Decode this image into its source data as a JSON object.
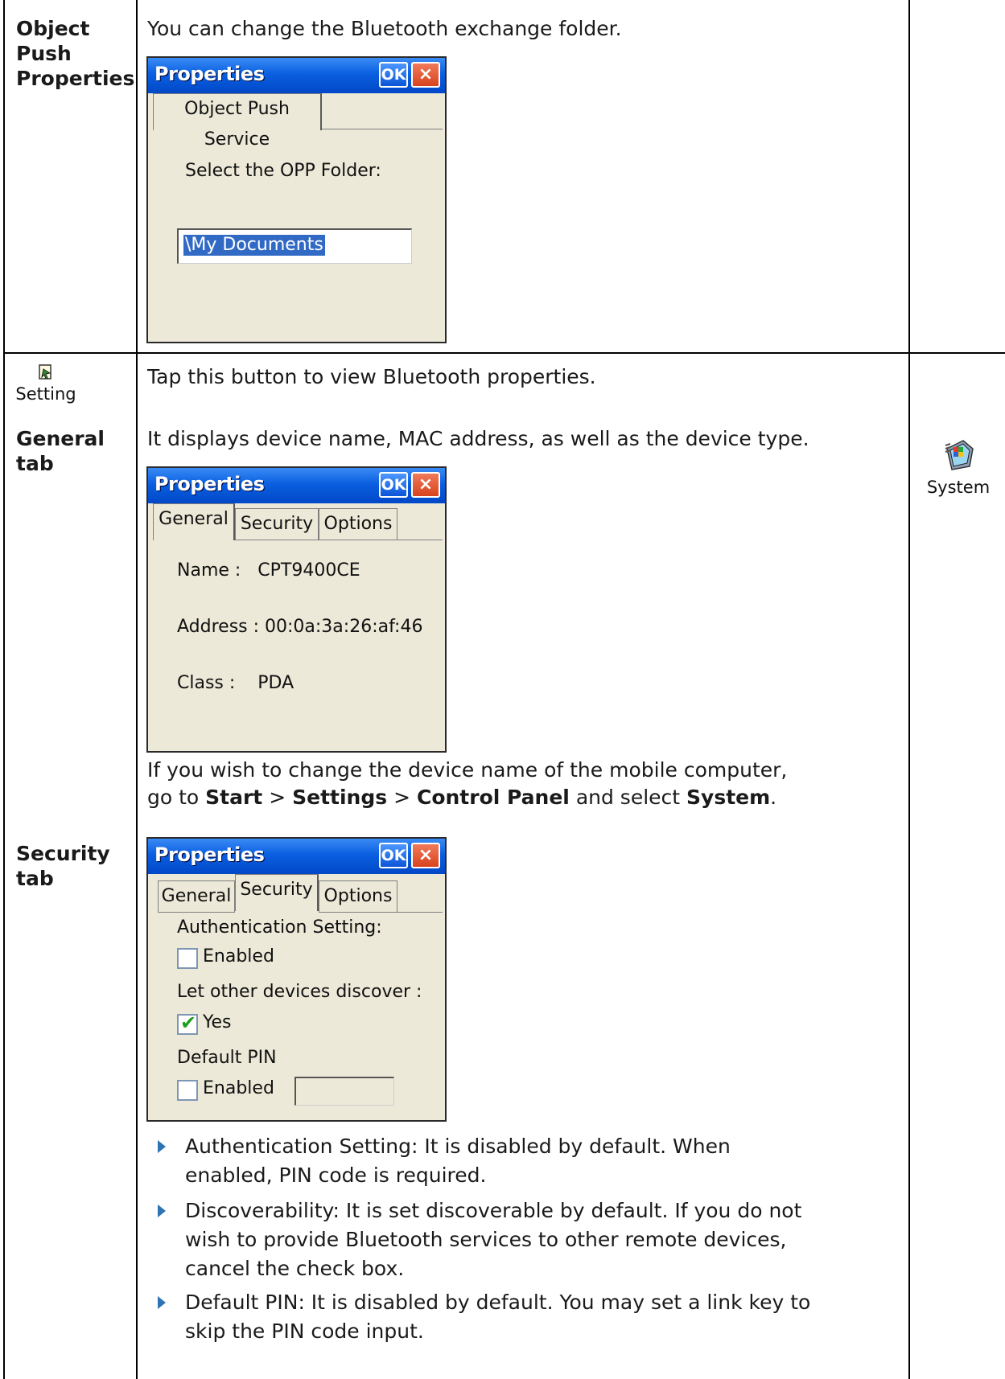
{
  "row1": {
    "label": [
      "Object",
      "Push",
      "Properties"
    ],
    "description": "You can change the Bluetooth exchange folder.",
    "dialog": {
      "title": "Properties",
      "ok": "OK",
      "close": "×",
      "tab": "Object Push Service",
      "prompt": "Select the OPP Folder:",
      "folder_value": "\\My Documents"
    }
  },
  "row2": {
    "setting_button_label": "Setting",
    "setting_description": "Tap this button to view Bluetooth properties.",
    "general_label": [
      "General",
      "tab"
    ],
    "general_description": "It displays device name, MAC address, as well as the device type.",
    "general_dialog": {
      "title": "Properties",
      "ok": "OK",
      "close": "×",
      "tabs": [
        "General",
        "Security",
        "Options"
      ],
      "name_line": "Name :   CPT9400CE",
      "address_line": "Address : 00:0a:3a:26:af:46",
      "class_line": "Class :    PDA"
    },
    "change_name_line1": "If you wish to change the device name of the mobile computer,",
    "change_name_line2": {
      "go_to": "go to ",
      "start": "Start",
      "sep1": " > ",
      "settings": "Settings",
      "sep2": " > ",
      "control_panel": "Control Panel",
      "and_select": " and select ",
      "system": "System",
      "period": "."
    },
    "system_icon_label": "System",
    "security_label": [
      "Security",
      "tab"
    ],
    "security_dialog": {
      "title": "Properties",
      "ok": "OK",
      "close": "×",
      "tabs": [
        "General",
        "Security",
        "Options"
      ],
      "auth_heading": "Authentication Setting:",
      "auth_checkbox": "Enabled",
      "discover_heading": "Let other devices discover :",
      "discover_checkbox": "Yes",
      "pin_heading": "Default PIN",
      "pin_checkbox": "Enabled",
      "pin_value": ""
    },
    "bullets": [
      [
        "Authentication Setting: It is disabled by default. When",
        "enabled, PIN code is required."
      ],
      [
        "Discoverability: It is set discoverable by default. If you do not",
        "wish to provide Bluetooth services to other remote devices,",
        "cancel the check box."
      ],
      [
        "Default PIN: It is disabled by default. You may set a link key to",
        "skip the PIN code input."
      ]
    ]
  }
}
